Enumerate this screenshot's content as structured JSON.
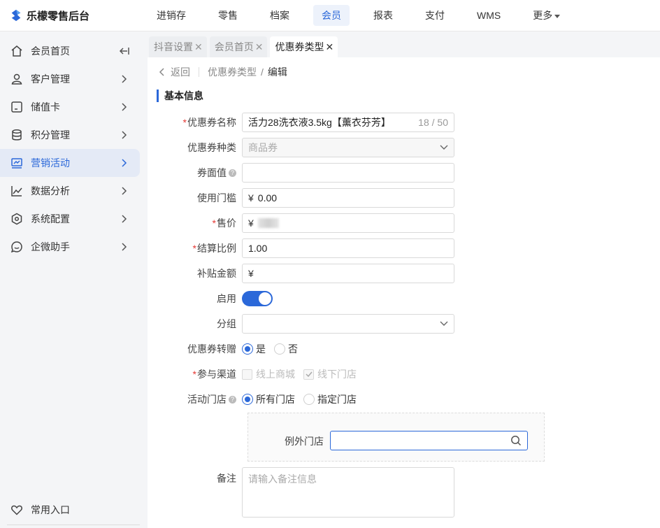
{
  "app": {
    "title": "乐檬零售后台"
  },
  "topnav": [
    {
      "label": "进销存"
    },
    {
      "label": "零售"
    },
    {
      "label": "档案"
    },
    {
      "label": "会员",
      "active": true
    },
    {
      "label": "报表"
    },
    {
      "label": "支付"
    },
    {
      "label": "WMS"
    },
    {
      "label": "更多"
    }
  ],
  "sidebar": {
    "items": [
      {
        "label": "会员首页",
        "icon": "home-icon"
      },
      {
        "label": "客户管理",
        "icon": "user-icon"
      },
      {
        "label": "储值卡",
        "icon": "card-icon"
      },
      {
        "label": "积分管理",
        "icon": "database-icon"
      },
      {
        "label": "营销活动",
        "icon": "monitor-chart-icon",
        "active": true
      },
      {
        "label": "数据分析",
        "icon": "line-chart-icon"
      },
      {
        "label": "系统配置",
        "icon": "settings-hex-icon"
      },
      {
        "label": "企微助手",
        "icon": "chat-bubble-icon"
      }
    ],
    "favorite": {
      "label": "常用入口",
      "icon": "heart-icon"
    }
  },
  "tabs": [
    {
      "label": "抖音设置"
    },
    {
      "label": "会员首页"
    },
    {
      "label": "优惠券类型",
      "active": true
    }
  ],
  "breadcrumb": {
    "back": "返回",
    "parent": "优惠券类型",
    "separator": "/",
    "current": "编辑"
  },
  "section": {
    "title": "基本信息"
  },
  "form": {
    "name": {
      "label": "优惠券名称",
      "value": "活力28洗衣液3.5kg【薰衣芬芳】",
      "count": "18 / 50"
    },
    "kind": {
      "label": "优惠券种类",
      "value": "商品券"
    },
    "face_value": {
      "label": "券面值",
      "value": ""
    },
    "threshold": {
      "label": "使用门槛",
      "currency": "¥",
      "value": "0.00"
    },
    "price": {
      "label": "售价",
      "currency": "¥"
    },
    "settle_ratio": {
      "label": "结算比例",
      "value": "1.00"
    },
    "subsidy": {
      "label": "补贴金额",
      "currency": "¥",
      "value": ""
    },
    "enabled": {
      "label": "启用",
      "on": true
    },
    "group": {
      "label": "分组",
      "value": ""
    },
    "transfer": {
      "label": "优惠券转赠",
      "options": [
        "是",
        "否"
      ],
      "selected": "是"
    },
    "channel": {
      "label": "参与渠道",
      "options": [
        {
          "label": "线上商城",
          "checked": false
        },
        {
          "label": "线下门店",
          "checked": true
        }
      ]
    },
    "stores": {
      "label": "活动门店",
      "options": [
        "所有门店",
        "指定门店"
      ],
      "selected": "所有门店"
    },
    "exception": {
      "label": "例外门店",
      "value": ""
    },
    "remark": {
      "label": "备注",
      "placeholder": "请输入备注信息"
    }
  },
  "colors": {
    "accent": "#2b68d9",
    "required": "#e53935",
    "sidebar_bg": "#f4f5f7"
  }
}
